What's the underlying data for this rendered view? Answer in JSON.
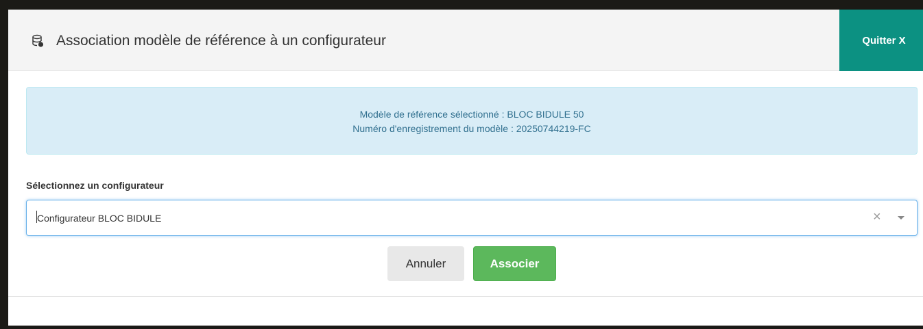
{
  "modal": {
    "title": "Association modèle de référence à un configurateur",
    "header_icon": "database-icon",
    "quit_label": "Quitter X"
  },
  "info": {
    "line1": "Modèle de référence sélectionné : BLOC BIDULE 50",
    "line2": "Numéro d'enregistrement du modèle : 20250744219-FC"
  },
  "form": {
    "label": "Sélectionnez un configurateur",
    "selected_value": "Configurateur BLOC BIDULE",
    "clear_symbol": "×"
  },
  "buttons": {
    "cancel_label": "Annuler",
    "associate_label": "Associer"
  },
  "colors": {
    "accent": "#0c9182",
    "info_bg": "#d9edf7",
    "info_text": "#31708f",
    "success": "#5cb85c"
  }
}
